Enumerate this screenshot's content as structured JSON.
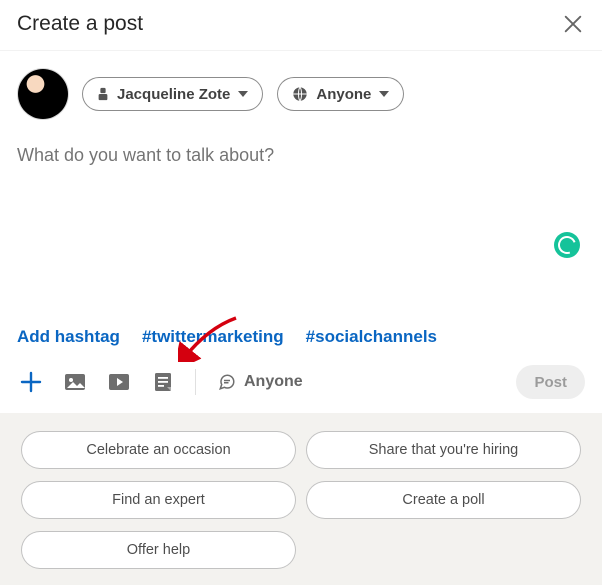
{
  "header": {
    "title": "Create a post"
  },
  "identity": {
    "author_name": "Jacqueline Zote",
    "visibility_chip": "Anyone"
  },
  "editor": {
    "placeholder": "What do you want to talk about?"
  },
  "hashtags": {
    "add_label": "Add hashtag",
    "suggested": [
      "#twittermarketing",
      "#socialchannels"
    ]
  },
  "toolbar": {
    "visibility_label": "Anyone",
    "post_label": "Post"
  },
  "suggestions": [
    "Celebrate an occasion",
    "Share that you're hiring",
    "Find an expert",
    "Create a poll",
    "Offer help"
  ]
}
